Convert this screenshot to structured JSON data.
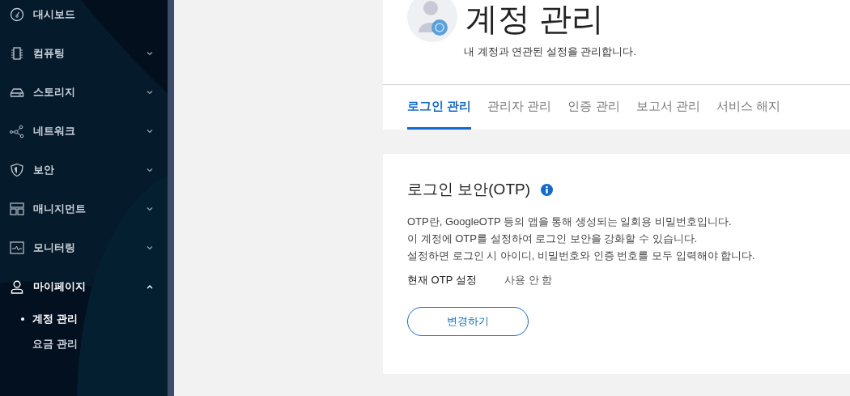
{
  "sidebar": {
    "items": [
      {
        "label": "대시보드",
        "kind": "link"
      },
      {
        "label": "컴퓨팅",
        "kind": "group",
        "expanded": false
      },
      {
        "label": "스토리지",
        "kind": "group",
        "expanded": false
      },
      {
        "label": "네트워크",
        "kind": "group",
        "expanded": false
      },
      {
        "label": "보안",
        "kind": "group",
        "expanded": false
      },
      {
        "label": "매니지먼트",
        "kind": "group",
        "expanded": false
      },
      {
        "label": "모니터링",
        "kind": "group",
        "expanded": false
      },
      {
        "label": "마이페이지",
        "kind": "group",
        "expanded": true,
        "children": [
          {
            "label": "계정 관리",
            "selected": true
          },
          {
            "label": "요금 관리",
            "selected": false
          }
        ]
      }
    ]
  },
  "header": {
    "title": "계정 관리",
    "subtitle": "내 계정과 연관된 설정을 관리합니다."
  },
  "tabs": [
    {
      "label": "로그인 관리",
      "selected": true
    },
    {
      "label": "관리자 관리",
      "selected": false
    },
    {
      "label": "인증 관리",
      "selected": false
    },
    {
      "label": "보고서 관리",
      "selected": false
    },
    {
      "label": "서비스 해지",
      "selected": false
    }
  ],
  "card": {
    "title": "로그인 보안(OTP)",
    "description": [
      "OTP란, GoogleOTP 등의 앱을 통해 생성되는 일회용 비밀번호입니다.",
      "이 계정에 OTP를 설정하여 로그인 보안을 강화할 수 있습니다.",
      "설정하면 로그인 시 아이디, 비밀번호와 인증 번호를 모두 입력해야 합니다."
    ],
    "setting_label": "현재 OTP 설정",
    "setting_value": "사용 안 함",
    "button": "변경하기"
  }
}
